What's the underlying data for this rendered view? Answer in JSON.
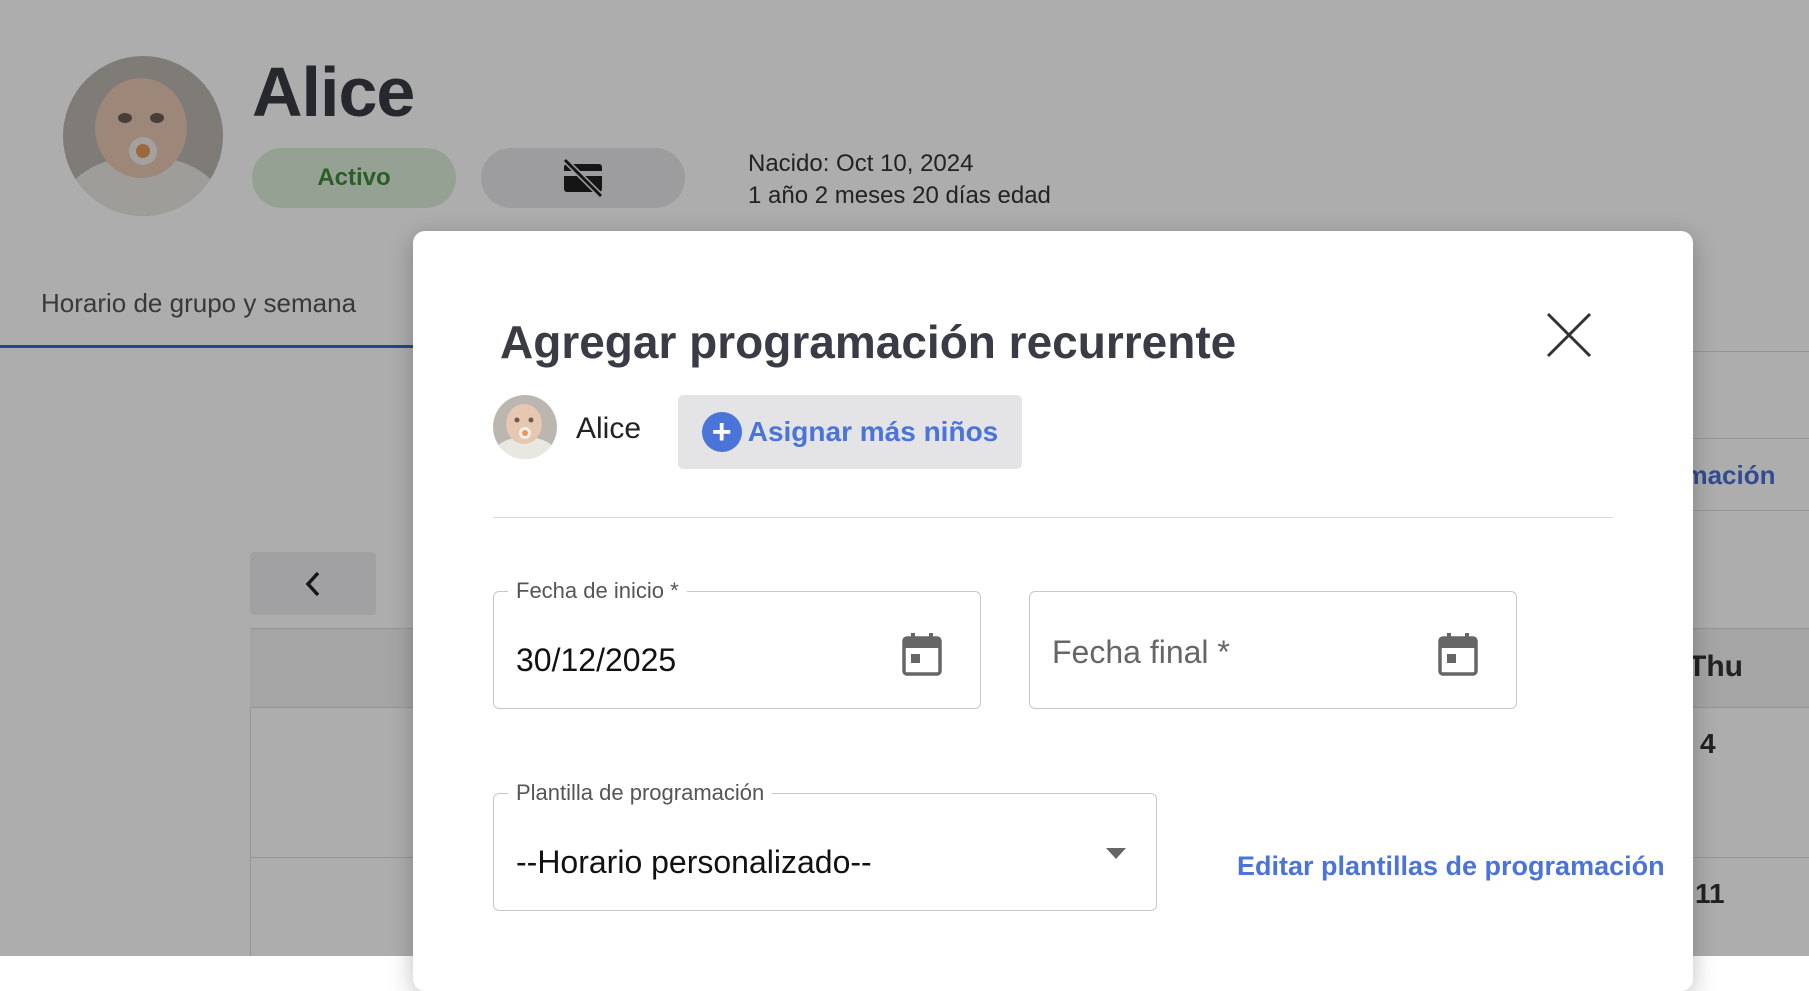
{
  "profile": {
    "name": "Alice",
    "status_label": "Activo",
    "born_line": "Nacido: Oct 10, 2024",
    "age_line": "1 año 2 meses 20 días edad",
    "card_icon": "no-card-icon"
  },
  "tabs": {
    "active_label": "Horario de grupo y semana"
  },
  "background": {
    "right_link_partial": "amación",
    "prev_icon": "chevron-left-icon",
    "calendar_day_header": "Thu",
    "calendar_dates": [
      "4",
      "11"
    ]
  },
  "modal": {
    "title": "Agregar programación recurrente",
    "close_icon": "close-icon",
    "child_name": "Alice",
    "assign_label": "Asignar más niños",
    "start_date": {
      "label": "Fecha de inicio *",
      "value": "30/12/2025",
      "icon": "calendar-icon"
    },
    "end_date": {
      "placeholder": "Fecha final *",
      "icon": "calendar-icon"
    },
    "template": {
      "label": "Plantilla de programación",
      "value": "--Horario personalizado--"
    },
    "edit_templates_link": "Editar plantillas de programación"
  },
  "colors": {
    "accent": "#4a74d8",
    "status_green_bg": "#dcefd9",
    "status_green_text": "#3e8a3a",
    "tab_underline": "#2f6fc4"
  }
}
